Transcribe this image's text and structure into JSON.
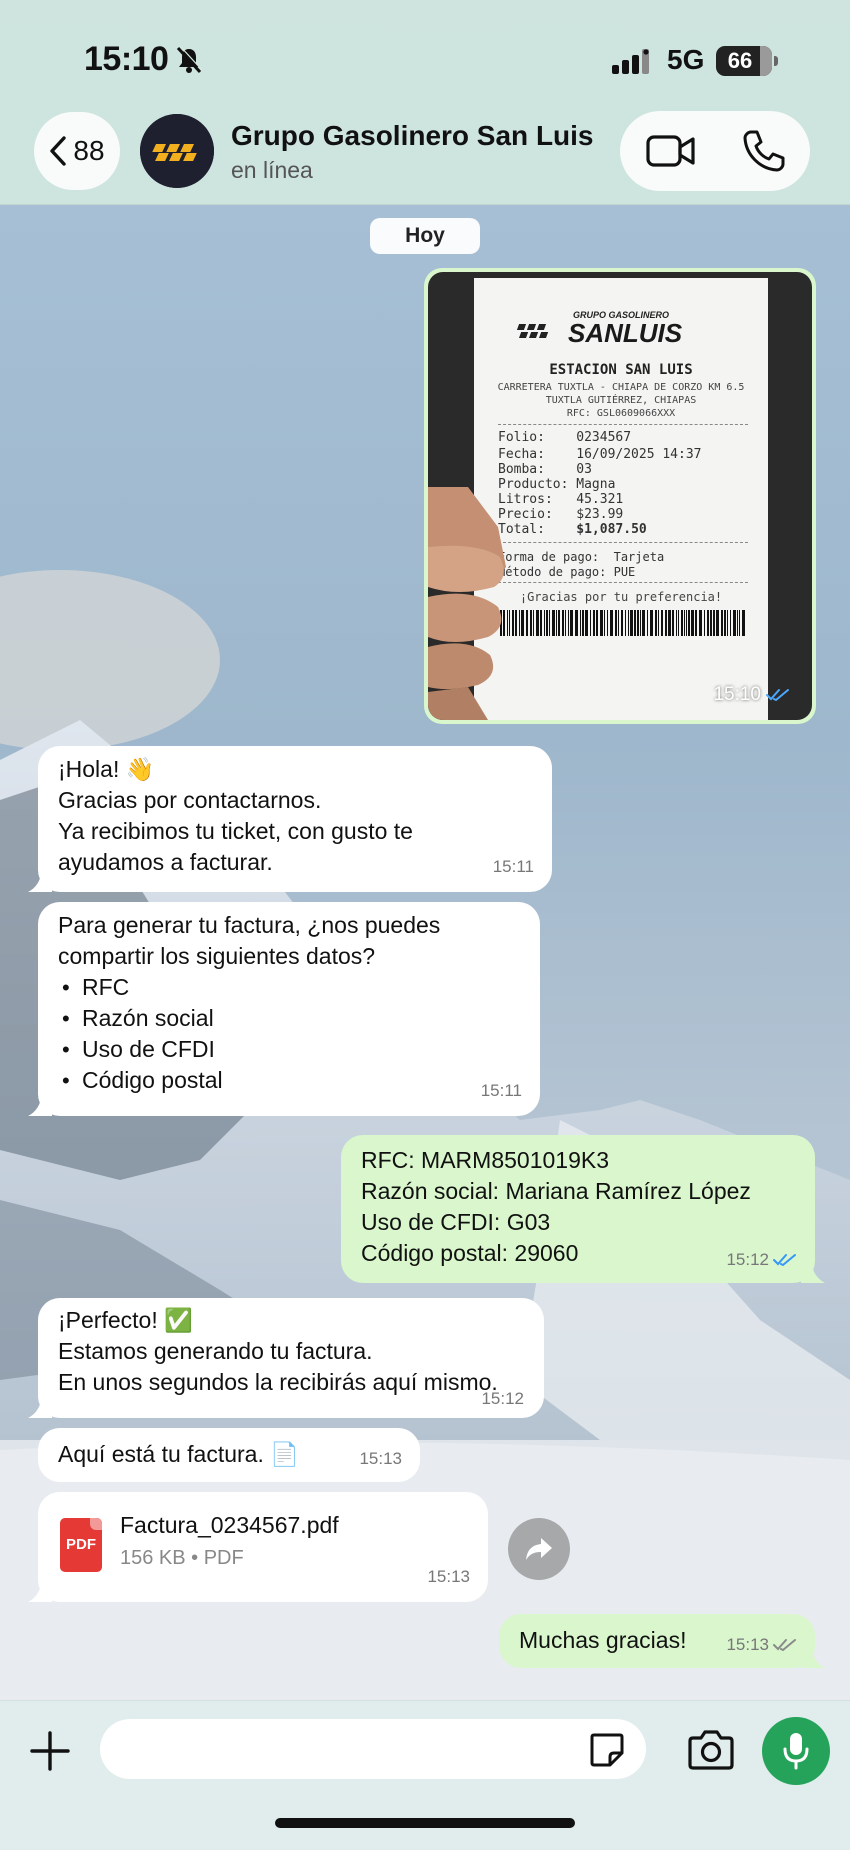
{
  "status_bar": {
    "time": "15:10",
    "network": "5G",
    "battery": "66"
  },
  "header": {
    "back_count": "88",
    "contact_name": "Grupo Gasolinero San Luis",
    "contact_status": "en línea"
  },
  "date_chip": "Hoy",
  "receipt_image": {
    "time": "15:10",
    "brand_small": "GRUPO GASOLINERO",
    "brand": "SANLUIS",
    "station": "ESTACION SAN LUIS",
    "address1": "CARRETERA TUXTLA - CHIAPA DE CORZO KM 6.5",
    "address2": "TUXTLA GUTIÉRREZ, CHIAPAS",
    "rfc": "RFC: GSL0609066XXX",
    "rows": {
      "folio": "Folio:    0234567",
      "fecha": "Fecha:    16/09/2025 14:37",
      "bomba": "Bomba:    03",
      "producto": "Producto: Magna",
      "litros": "Litros:   45.321",
      "precio": "Precio:   $23.99",
      "total_label": "Total:    ",
      "total_value": "$1,087.50",
      "forma": "Forma de pago:  Tarjeta",
      "metodo": "Método de pago: PUE"
    },
    "thanks": "¡Gracias por tu preferencia!"
  },
  "messages": {
    "m1": {
      "lines": [
        "¡Hola! 👋",
        "Gracias por contactarnos.",
        "Ya recibimos tu ticket, con gusto te",
        "ayudamos a facturar."
      ],
      "time": "15:11"
    },
    "m2": {
      "lines": [
        "Para generar tu factura, ¿nos puedes",
        "compartir los siguientes datos?"
      ],
      "items": [
        "RFC",
        "Razón social",
        "Uso de CFDI",
        "Código postal"
      ],
      "time": "15:11"
    },
    "m3": {
      "lines": [
        "RFC:  MARM8501019K3",
        "Razón social: Mariana Ramírez López",
        "Uso de CFDI: G03",
        "Código postal: 29060"
      ],
      "time": "15:12"
    },
    "m4": {
      "lines": [
        "¡Perfecto! ✅",
        "Estamos generando tu factura.",
        "En unos segundos la recibirás aquí mismo."
      ],
      "time": "15:12"
    },
    "m5": {
      "text": "Aquí está tu factura. 📄",
      "time": "15:13"
    },
    "m6": {
      "pdf_badge": "PDF",
      "file_name": "Factura_0234567.pdf",
      "file_meta": "156 KB • PDF",
      "time": "15:13"
    },
    "m7": {
      "text": "Muchas gracias!",
      "time": "15:13"
    }
  },
  "icons": {
    "read_check_color": "#3497f9",
    "sent_check_color": "#8a8a8a",
    "mic_bg": "#25a35a"
  }
}
